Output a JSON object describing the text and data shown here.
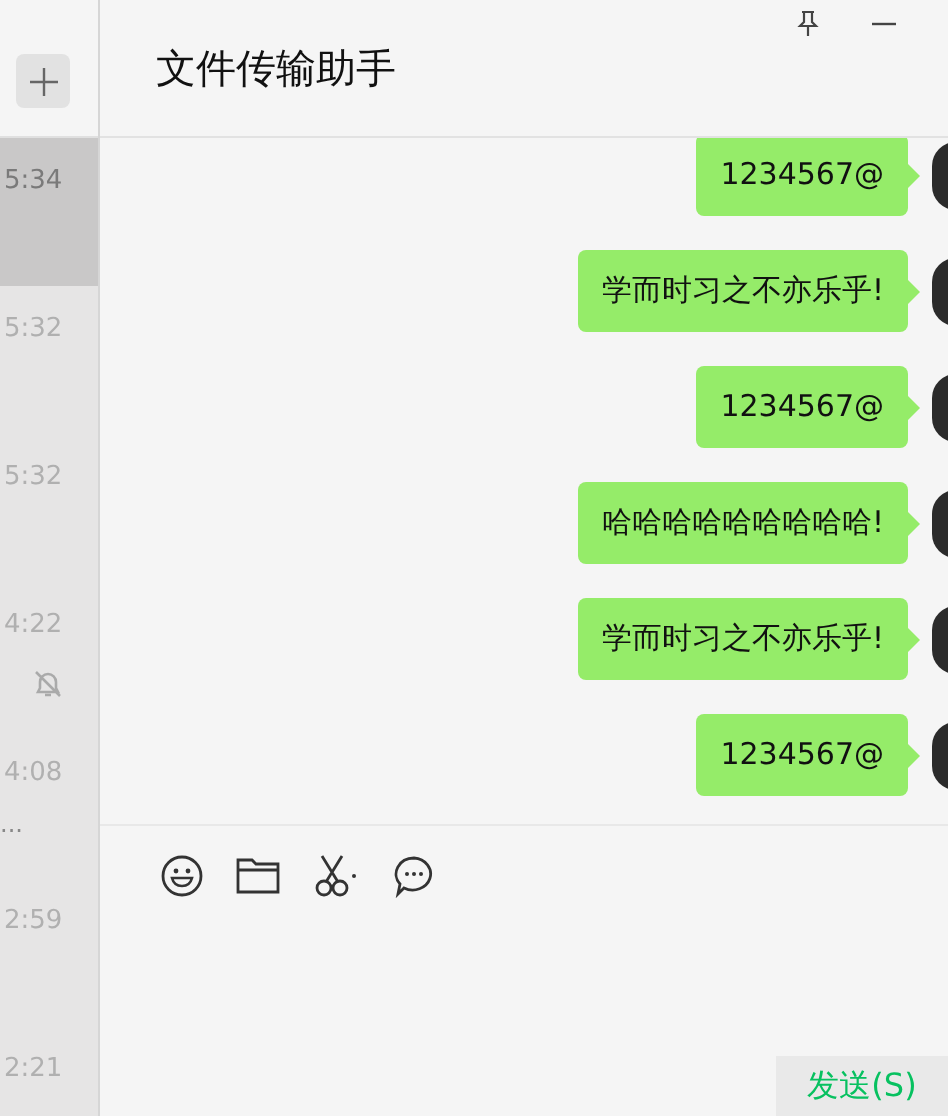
{
  "sidebar": {
    "chats": [
      {
        "time": "5:34",
        "selected": true,
        "muted": false
      },
      {
        "time": "5:32",
        "selected": false,
        "muted": false
      },
      {
        "time": "5:32",
        "selected": false,
        "muted": false
      },
      {
        "time": "4:22",
        "selected": false,
        "muted": true
      },
      {
        "time": "4:08",
        "selected": false,
        "muted": false,
        "preview": "..."
      },
      {
        "time": "2:59",
        "selected": false,
        "muted": false
      },
      {
        "time": "2:21",
        "selected": false,
        "muted": false
      }
    ]
  },
  "chat": {
    "title": "文件传输助手",
    "messages": [
      {
        "text": "1234567@"
      },
      {
        "text": "学而时习之不亦乐乎!"
      },
      {
        "text": "1234567@"
      },
      {
        "text": "哈哈哈哈哈哈哈哈哈!"
      },
      {
        "text": "学而时习之不亦乐乎!"
      },
      {
        "text": "1234567@"
      }
    ]
  },
  "composer": {
    "send_button": "发送(S)"
  }
}
